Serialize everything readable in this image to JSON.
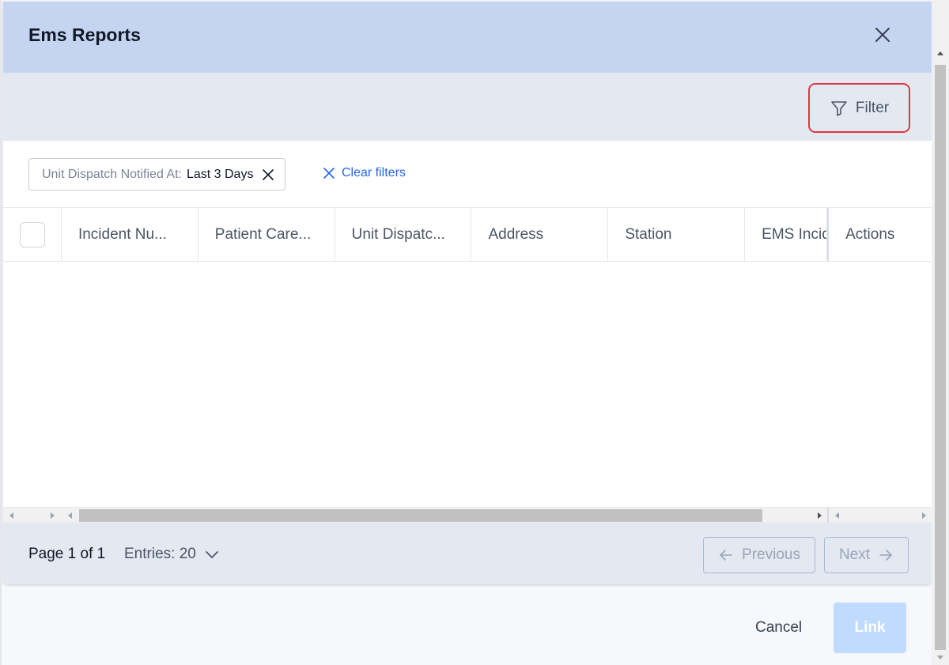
{
  "modal": {
    "title": "Ems Reports"
  },
  "toolbar": {
    "filter_label": "Filter"
  },
  "active_filters": [
    {
      "key": "Unit Dispatch Notified At:",
      "value": "Last 3 Days"
    }
  ],
  "clear_filters_label": "Clear filters",
  "table": {
    "columns": [
      "Incident Nu...",
      "Patient Care...",
      "Unit Dispatc...",
      "Address",
      "Station",
      "EMS Incid",
      "Actions"
    ],
    "rows": []
  },
  "pagination": {
    "page_info": "Page 1 of 1",
    "entries_label": "Entries: 20",
    "previous_label": "Previous",
    "next_label": "Next"
  },
  "actions": {
    "cancel_label": "Cancel",
    "link_label": "Link"
  },
  "colors": {
    "header_bg": "#c5d5f1",
    "toolbar_bg": "#e3e8f1",
    "filter_highlight": "#e03845",
    "link_accent": "#2563eb",
    "link_button_disabled": "#bfdbfe"
  }
}
